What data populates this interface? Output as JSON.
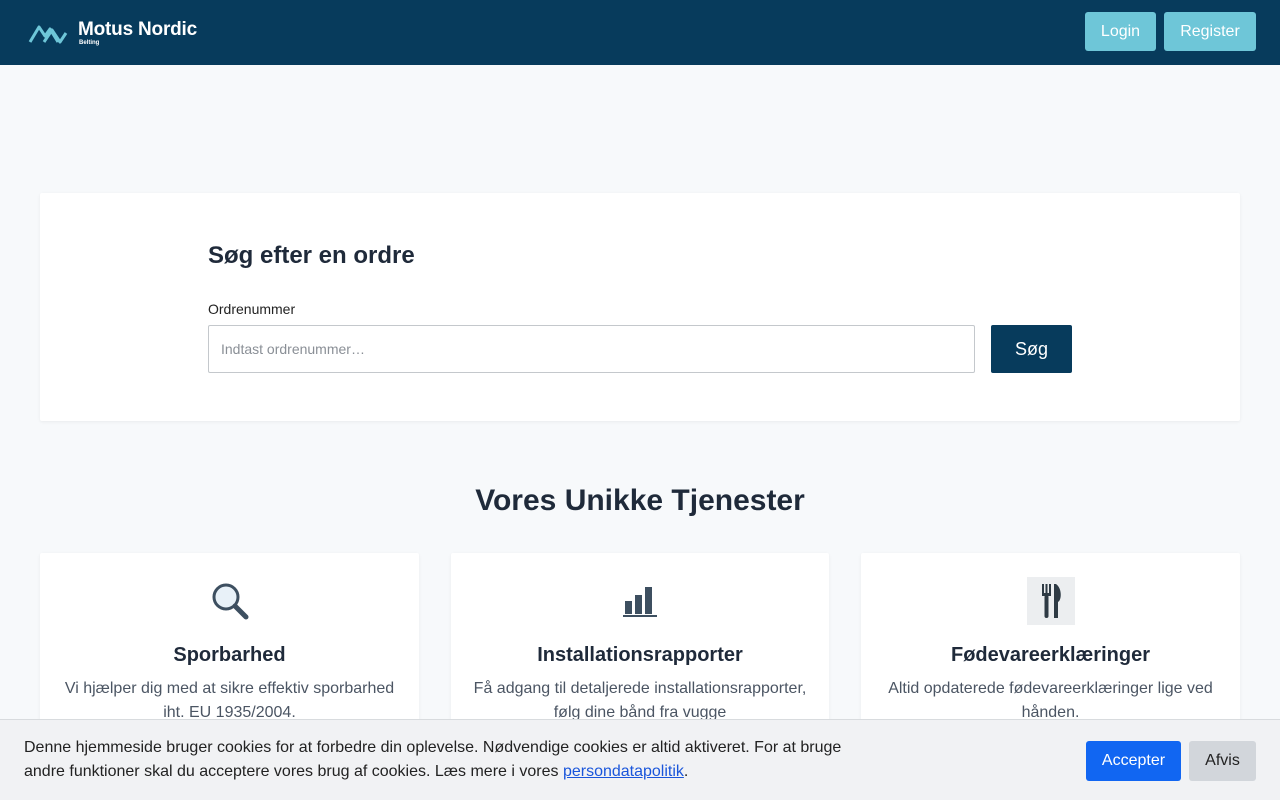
{
  "header": {
    "brand_name": "Motus Nordic",
    "brand_sub": "Belting",
    "login_label": "Login",
    "register_label": "Register"
  },
  "search": {
    "title": "Søg efter en ordre",
    "label": "Ordrenummer",
    "placeholder": "Indtast ordrenummer…",
    "button_label": "Søg"
  },
  "services": {
    "heading": "Vores Unikke Tjenester",
    "items": [
      {
        "icon": "magnifier-icon",
        "title": "Sporbarhed",
        "description": "Vi hjælper dig med at sikre effektiv sporbarhed iht. EU 1935/2004."
      },
      {
        "icon": "bar-chart-icon",
        "title": "Installationsrapporter",
        "description": "Få adgang til detaljerede installationsrapporter, følg dine bånd fra vugge"
      },
      {
        "icon": "fork-knife-icon",
        "title": "Fødevareerklæringer",
        "description": "Altid opdaterede fødevareerklæringer lige ved hånden."
      }
    ]
  },
  "cookie": {
    "text": "Denne hjemmeside bruger cookies for at forbedre din oplevelse. Nødvendige cookies er altid aktiveret. For at bruge andre funktioner skal du acceptere vores brug af cookies. Læs mere i vores ",
    "link_label": "persondatapolitik",
    "text_end": ".",
    "accept_label": "Accepter",
    "decline_label": "Afvis"
  },
  "colors": {
    "header_bg": "#073b5c",
    "nav_button": "#6ec6d8",
    "accept_button": "#1166f2",
    "link": "#1a56db"
  }
}
